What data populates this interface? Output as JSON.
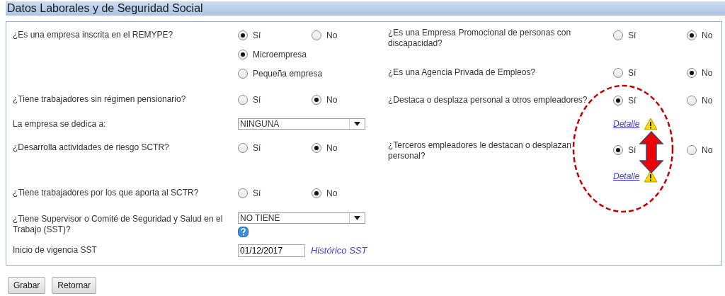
{
  "section_title": "Datos Laborales y de Seguridad Social",
  "left_questions": [
    {
      "kind": "radio",
      "label": "¿Es una empresa inscrita en el REMYPE?",
      "options": [
        {
          "label": "Sí",
          "selected": true
        },
        {
          "label": "No",
          "selected": false
        }
      ],
      "sub_options": [
        {
          "label": "Microempresa",
          "selected": true
        },
        {
          "label": "Pequeña empresa",
          "selected": false
        }
      ]
    },
    {
      "kind": "radio",
      "label": "¿Tiene trabajadores sin régimen pensionario?",
      "options": [
        {
          "label": "Sí",
          "selected": false
        },
        {
          "label": "No",
          "selected": true
        }
      ]
    },
    {
      "kind": "select",
      "label": "La empresa se dedica a:",
      "value": "NINGUNA"
    },
    {
      "kind": "radio",
      "label": "¿Desarrolla actividades de riesgo SCTR?",
      "options": [
        {
          "label": "Sí",
          "selected": false
        },
        {
          "label": "No",
          "selected": true
        }
      ]
    },
    {
      "kind": "radio",
      "label": "¿Tiene trabajadores por los que aporta al SCTR?",
      "options": [
        {
          "label": "Sí",
          "selected": false
        },
        {
          "label": "No",
          "selected": true
        }
      ]
    },
    {
      "kind": "select",
      "label": "¿Tiene Supervisor o Comité de Seguridad y Salud en el Trabajo (SST)?",
      "value": "NO TIENE",
      "help": true
    },
    {
      "kind": "date",
      "label": "Inicio de vigencia SST",
      "value": "01/12/2017",
      "link": "Histórico SST"
    }
  ],
  "right_questions": [
    {
      "kind": "radio",
      "label": "¿Es una Empresa Promocional de personas con discapacidad?",
      "options": [
        {
          "label": "Sí",
          "selected": false
        },
        {
          "label": "No",
          "selected": true
        }
      ]
    },
    {
      "kind": "radio",
      "label": "¿Es una Agencia Privada de Empleos?",
      "options": [
        {
          "label": "Sí",
          "selected": false
        },
        {
          "label": "No",
          "selected": true
        }
      ]
    },
    {
      "kind": "radio",
      "label": "¿Destaca o desplaza personal a otros empleadores?",
      "options": [
        {
          "label": "Sí",
          "selected": true
        },
        {
          "label": "No",
          "selected": false
        }
      ],
      "detail_link": "Detalle",
      "warning": true
    },
    {
      "kind": "radio",
      "label": "¿Terceros empleadores le destacan o desplazan personal?",
      "options": [
        {
          "label": "Sí",
          "selected": true
        },
        {
          "label": "No",
          "selected": false
        }
      ],
      "detail_link": "Detalle",
      "warning": true
    }
  ],
  "buttons": [
    "Grabar",
    "Retornar"
  ]
}
